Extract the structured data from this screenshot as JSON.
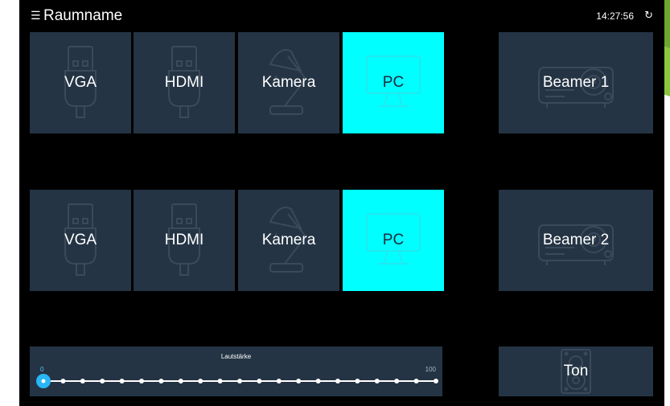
{
  "header": {
    "menu_icon": "☰",
    "room_name": "Raumname",
    "time": "14:27:56",
    "refresh_icon": "↻"
  },
  "rows": [
    {
      "sources": [
        {
          "label": "VGA",
          "icon": "usb-plug-icon",
          "active": false
        },
        {
          "label": "HDMI",
          "icon": "usb-plug-icon",
          "active": false
        },
        {
          "label": "Kamera",
          "icon": "desk-lamp-icon",
          "active": false
        },
        {
          "label": "PC",
          "icon": "monitor-icon",
          "active": true
        }
      ],
      "output": {
        "label": "Beamer 1",
        "icon": "projector-icon"
      }
    },
    {
      "sources": [
        {
          "label": "VGA",
          "icon": "usb-plug-icon",
          "active": false
        },
        {
          "label": "HDMI",
          "icon": "usb-plug-icon",
          "active": false
        },
        {
          "label": "Kamera",
          "icon": "desk-lamp-icon",
          "active": false
        },
        {
          "label": "PC",
          "icon": "monitor-icon",
          "active": true
        }
      ],
      "output": {
        "label": "Beamer 2",
        "icon": "projector-icon"
      }
    }
  ],
  "volume": {
    "title": "Lautstärke",
    "min_label": "0",
    "max_label": "100",
    "value": 0,
    "steps": 20
  },
  "audio_button": {
    "label": "Ton",
    "icon": "speaker-icon"
  },
  "colors": {
    "tile": "#243444",
    "active": "#00ffff",
    "accent": "#29b6f6",
    "background": "#000000"
  }
}
